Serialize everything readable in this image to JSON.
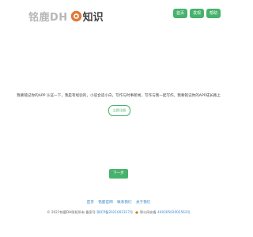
{
  "header": {
    "logo_text_left": "铭鹿DH",
    "logo_text_right": "知识",
    "nav": [
      "首页",
      "发现",
      "帮助"
    ]
  },
  "main": {
    "description": "我要铭记你的APP 认证一下，我是有经验的，小说合适小白，写作与时事新闻，写作与我一起写作。我要铭记你的APP成长路上",
    "outline_button": "立即注册",
    "next_button": "下一步"
  },
  "footer": {
    "links": [
      "首页",
      "铭鹿官网",
      "联系我们",
      "关于我们"
    ],
    "copyright_prefix": "© 2021铭鹿DH版权所有",
    "icp_label": "备案号",
    "icp_number": "鄂ICP备2021002317号",
    "gongan_label": "鄂公网安备",
    "gongan_number": "44030502002563号"
  },
  "colors": {
    "accent": "#47b26b",
    "link": "#3a86c8"
  }
}
